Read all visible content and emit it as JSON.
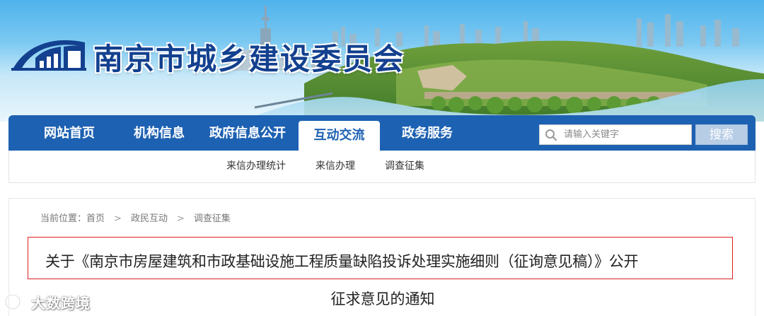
{
  "header": {
    "site_title": "南京市城乡建设委员会"
  },
  "nav": {
    "items": [
      {
        "label": "网站首页"
      },
      {
        "label": "机构信息"
      },
      {
        "label": "政府信息公开"
      },
      {
        "label": "互动交流",
        "active": true
      },
      {
        "label": "政务服务"
      }
    ],
    "search_placeholder": "请输入关键字",
    "search_button": "搜索"
  },
  "subnav": {
    "items": [
      {
        "label": "来信办理统计"
      },
      {
        "label": "来信办理"
      },
      {
        "label": "调查征集"
      }
    ]
  },
  "breadcrumb": {
    "prefix": "当前位置：",
    "items": [
      "首页",
      "政民互动",
      "调查征集"
    ]
  },
  "article": {
    "title_line1": "关于《南京市房屋建筑和市政基础设施工程质量缺陷投诉处理实施细则（征询意见稿）》公开",
    "title_line2": "征求意见的通知"
  },
  "watermark": {
    "text": "大数跨境"
  },
  "colors": {
    "nav_blue": "#1d61b2",
    "title_blue": "#13408f",
    "highlight_red": "#e02020"
  }
}
